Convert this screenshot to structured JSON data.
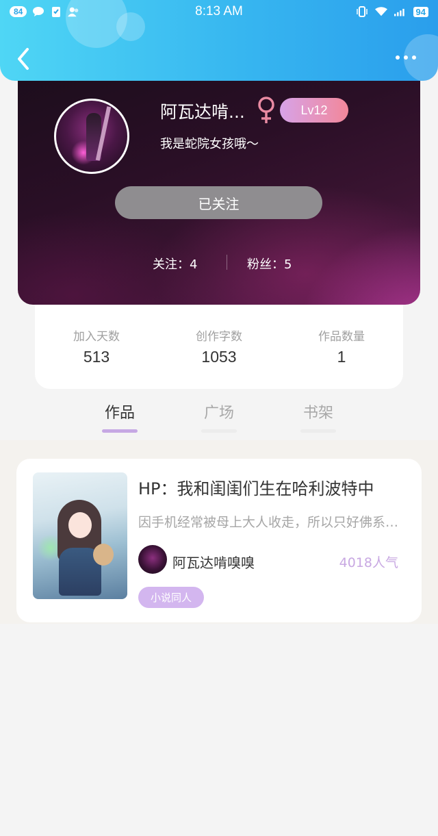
{
  "status_bar": {
    "notification_count": "84",
    "time": "8:13 AM",
    "battery": "94"
  },
  "header": {
    "back_icon": "chevron-left-icon",
    "more_icon": "more-horizontal-icon"
  },
  "profile": {
    "username": "阿瓦达啃...",
    "gender_icon": "female-icon",
    "level": "Lv12",
    "bio": "我是蛇院女孩哦～",
    "follow_button": "已关注",
    "following": "关注：4",
    "fans": "粉丝：5"
  },
  "info": {
    "items": [
      {
        "label": "加入天数",
        "value": "513"
      },
      {
        "label": "创作字数",
        "value": "1053"
      },
      {
        "label": "作品数量",
        "value": "1"
      }
    ]
  },
  "tabs": [
    {
      "label": "作品",
      "active": true
    },
    {
      "label": "广场",
      "active": false
    },
    {
      "label": "书架",
      "active": false
    }
  ],
  "work": {
    "title": "HP：我和闺闺们生在哈利波特中",
    "description": "因手机经常被母上大人收走，所以只好佛系更...",
    "author": "阿瓦达啃嗅嗅",
    "popularity": "4018人气",
    "tag": "小说同人"
  },
  "colors": {
    "header_gradient_start": "#4fd6f5",
    "header_gradient_end": "#2a9eec",
    "level_badge_start": "#d7a3e8",
    "level_badge_end": "#f2879a",
    "tab_active_bar": "#c6a8e4",
    "tag_bg": "#d3b6ef",
    "popularity_text": "#c8a8e2"
  }
}
